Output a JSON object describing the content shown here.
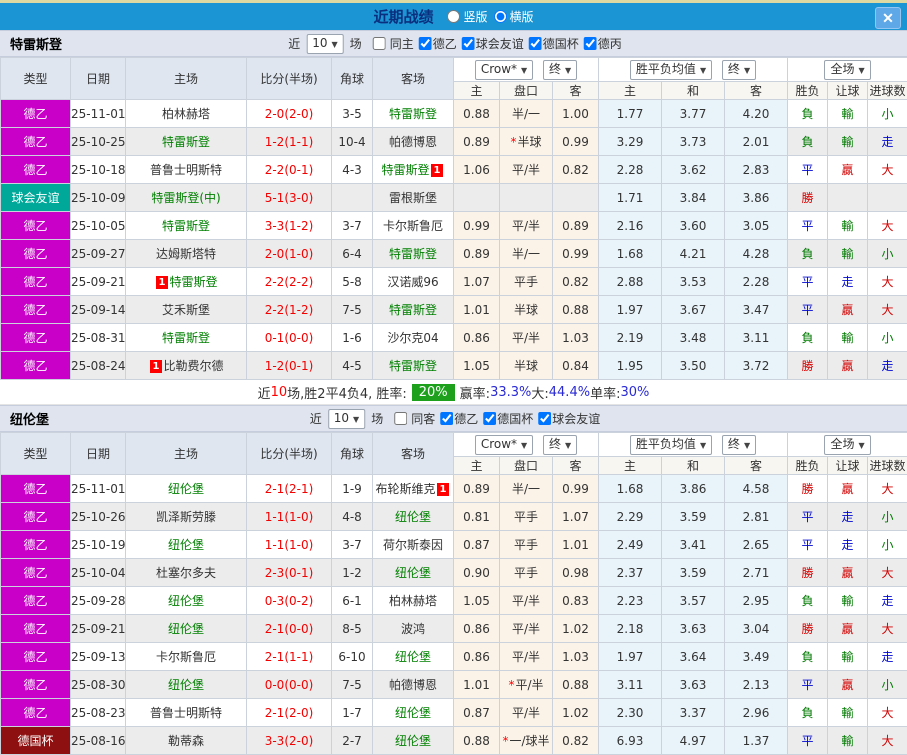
{
  "titlebar": {
    "title": "近期战绩",
    "radios": [
      {
        "label": "竖版",
        "checked": false
      },
      {
        "label": "横版",
        "checked": true
      }
    ],
    "close_icon": "✕"
  },
  "icons": {
    "chevron_down": "▼",
    "close": "✕"
  },
  "colors": {
    "titlebar_bg": "#1c95d4",
    "title_text": "#0a2f7e",
    "league_de2": "#c800c8",
    "league_friendly": "#00a89a",
    "league_decup": "#8f1010",
    "score_red": "#f30000",
    "focus_team_green": "#008000",
    "win_red": "#d30000",
    "draw_blue": "#0008d0",
    "lose_green": "#007a00",
    "odds_bg": "#fbf3e8",
    "avg_bg": "#e9f4fa",
    "rate_badge_bg": "#1da11d",
    "stat_value_blue": "#2a2ad4"
  },
  "table": {
    "cols": {
      "type": "类型",
      "date": "日期",
      "home": "主场",
      "score": "比分(半场)",
      "corner": "角球",
      "away": "客场",
      "odds_home": "主",
      "handicap": "盘口",
      "odds_away": "客",
      "avg_home": "主",
      "avg_draw": "和",
      "avg_away": "客",
      "result": "胜负",
      "handicap_result": "让球",
      "goals": "进球数"
    },
    "dropdowns": {
      "odds_source": "Crow*",
      "odds_final": "终",
      "avg_source": "胜平负均值",
      "avg_final": "终",
      "scope": "全场"
    }
  },
  "sections": [
    {
      "team": "特雷斯登",
      "filter": {
        "near_label": "近",
        "count": "10",
        "games_label": "场",
        "same": {
          "label": "同主",
          "checked": false
        },
        "leagues": [
          {
            "label": "德乙",
            "checked": true
          },
          {
            "label": "球会友谊",
            "checked": true
          },
          {
            "label": "德国杯",
            "checked": true
          },
          {
            "label": "德丙",
            "checked": true
          }
        ]
      },
      "rows": [
        {
          "type": "德乙",
          "type_key": "de2",
          "date": "25-11-01",
          "home": "柏林赫塔",
          "home_green": false,
          "score": "2-0(2-0)",
          "corner": "3-5",
          "away": "特雷斯登",
          "away_green": true,
          "odds_home": "0.88",
          "handicap": "半/一",
          "handicap_star": false,
          "odds_away": "1.00",
          "avg_home": "1.77",
          "avg_draw": "3.77",
          "avg_away": "4.20",
          "result": {
            "text": "負",
            "color": "green"
          },
          "handicap_result": {
            "text": "輸",
            "color": "green"
          },
          "goals": {
            "text": "小",
            "color": "green"
          }
        },
        {
          "type": "德乙",
          "type_key": "de2",
          "date": "25-10-25",
          "home": "特雷斯登",
          "home_green": true,
          "score": "1-2(1-1)",
          "corner": "10-4",
          "away": "帕德博恩",
          "away_green": false,
          "odds_home": "0.89",
          "handicap": "半球",
          "handicap_star": true,
          "odds_away": "0.99",
          "avg_home": "3.29",
          "avg_draw": "3.73",
          "avg_away": "2.01",
          "result": {
            "text": "負",
            "color": "green"
          },
          "handicap_result": {
            "text": "輸",
            "color": "green"
          },
          "goals": {
            "text": "走",
            "color": "blue"
          }
        },
        {
          "type": "德乙",
          "type_key": "de2",
          "date": "25-10-18",
          "home": "普鲁士明斯特",
          "home_green": false,
          "score": "2-2(0-1)",
          "corner": "4-3",
          "away": "特雷斯登",
          "away_green": true,
          "away_badge": "1",
          "away_badge_pos": "after",
          "odds_home": "1.06",
          "handicap": "平/半",
          "handicap_star": false,
          "odds_away": "0.82",
          "avg_home": "2.28",
          "avg_draw": "3.62",
          "avg_away": "2.83",
          "result": {
            "text": "平",
            "color": "blue"
          },
          "handicap_result": {
            "text": "贏",
            "color": "red"
          },
          "goals": {
            "text": "大",
            "color": "red"
          }
        },
        {
          "type": "球会友谊",
          "type_key": "friendly",
          "date": "25-10-09",
          "home": "特雷斯登(中)",
          "home_green": true,
          "score": "5-1(3-0)",
          "corner": "",
          "away": "雷根斯堡",
          "away_green": false,
          "odds_home": "",
          "handicap": "",
          "handicap_star": false,
          "odds_away": "",
          "avg_home": "1.71",
          "avg_draw": "3.84",
          "avg_away": "3.86",
          "result": {
            "text": "勝",
            "color": "red"
          },
          "handicap_result": {
            "text": "",
            "color": ""
          },
          "goals": {
            "text": "",
            "color": ""
          }
        },
        {
          "type": "德乙",
          "type_key": "de2",
          "date": "25-10-05",
          "home": "特雷斯登",
          "home_green": true,
          "score": "3-3(1-2)",
          "corner": "3-7",
          "away": "卡尔斯鲁厄",
          "away_green": false,
          "odds_home": "0.99",
          "handicap": "平/半",
          "handicap_star": false,
          "odds_away": "0.89",
          "avg_home": "2.16",
          "avg_draw": "3.60",
          "avg_away": "3.05",
          "result": {
            "text": "平",
            "color": "blue"
          },
          "handicap_result": {
            "text": "輸",
            "color": "green"
          },
          "goals": {
            "text": "大",
            "color": "red"
          }
        },
        {
          "type": "德乙",
          "type_key": "de2",
          "date": "25-09-27",
          "home": "达姆斯塔特",
          "home_green": false,
          "score": "2-0(1-0)",
          "corner": "6-4",
          "away": "特雷斯登",
          "away_green": true,
          "odds_home": "0.89",
          "handicap": "半/一",
          "handicap_star": false,
          "odds_away": "0.99",
          "avg_home": "1.68",
          "avg_draw": "4.21",
          "avg_away": "4.28",
          "result": {
            "text": "負",
            "color": "green"
          },
          "handicap_result": {
            "text": "輸",
            "color": "green"
          },
          "goals": {
            "text": "小",
            "color": "green"
          }
        },
        {
          "type": "德乙",
          "type_key": "de2",
          "date": "25-09-21",
          "home": "特雷斯登",
          "home_green": true,
          "home_badge": "1",
          "home_badge_pos": "before",
          "score": "2-2(2-2)",
          "corner": "5-8",
          "away": "汉诺威96",
          "away_green": false,
          "odds_home": "1.07",
          "handicap": "平手",
          "handicap_star": false,
          "odds_away": "0.82",
          "avg_home": "2.88",
          "avg_draw": "3.53",
          "avg_away": "2.28",
          "result": {
            "text": "平",
            "color": "blue"
          },
          "handicap_result": {
            "text": "走",
            "color": "blue"
          },
          "goals": {
            "text": "大",
            "color": "red"
          }
        },
        {
          "type": "德乙",
          "type_key": "de2",
          "date": "25-09-14",
          "home": "艾禾斯堡",
          "home_green": false,
          "score": "2-2(1-2)",
          "corner": "7-5",
          "away": "特雷斯登",
          "away_green": true,
          "odds_home": "1.01",
          "handicap": "半球",
          "handicap_star": false,
          "odds_away": "0.88",
          "avg_home": "1.97",
          "avg_draw": "3.67",
          "avg_away": "3.47",
          "result": {
            "text": "平",
            "color": "blue"
          },
          "handicap_result": {
            "text": "贏",
            "color": "red"
          },
          "goals": {
            "text": "大",
            "color": "red"
          }
        },
        {
          "type": "德乙",
          "type_key": "de2",
          "date": "25-08-31",
          "home": "特雷斯登",
          "home_green": true,
          "score": "0-1(0-0)",
          "corner": "1-6",
          "away": "沙尔克04",
          "away_green": false,
          "odds_home": "0.86",
          "handicap": "平/半",
          "handicap_star": false,
          "odds_away": "1.03",
          "avg_home": "2.19",
          "avg_draw": "3.48",
          "avg_away": "3.11",
          "result": {
            "text": "負",
            "color": "green"
          },
          "handicap_result": {
            "text": "輸",
            "color": "green"
          },
          "goals": {
            "text": "小",
            "color": "green"
          }
        },
        {
          "type": "德乙",
          "type_key": "de2",
          "date": "25-08-24",
          "home": "比勒费尔德",
          "home_green": false,
          "home_badge": "1",
          "home_badge_pos": "before",
          "score": "1-2(0-1)",
          "corner": "4-5",
          "away": "特雷斯登",
          "away_green": true,
          "odds_home": "1.05",
          "handicap": "半球",
          "handicap_star": false,
          "odds_away": "0.84",
          "avg_home": "1.95",
          "avg_draw": "3.50",
          "avg_away": "3.72",
          "result": {
            "text": "勝",
            "color": "red"
          },
          "handicap_result": {
            "text": "贏",
            "color": "red"
          },
          "goals": {
            "text": "走",
            "color": "blue"
          }
        }
      ],
      "summary": {
        "lead": [
          {
            "t": "近"
          },
          {
            "t": "10",
            "c": "red"
          },
          {
            "t": "场,胜2平4负4, 胜率:"
          }
        ],
        "rate": "20%",
        "stats": [
          {
            "label": "赢率:",
            "value": "33.3%"
          },
          {
            "label": " 大:",
            "value": "44.4%"
          },
          {
            "label": " 单率:",
            "value": "30%"
          }
        ]
      }
    },
    {
      "team": "纽伦堡",
      "filter": {
        "near_label": "近",
        "count": "10",
        "games_label": "场",
        "same": {
          "label": "同客",
          "checked": false
        },
        "leagues": [
          {
            "label": "德乙",
            "checked": true
          },
          {
            "label": "德国杯",
            "checked": true
          },
          {
            "label": "球会友谊",
            "checked": true
          }
        ]
      },
      "rows": [
        {
          "type": "德乙",
          "type_key": "de2",
          "date": "25-11-01",
          "home": "纽伦堡",
          "home_green": true,
          "score": "2-1(2-1)",
          "corner": "1-9",
          "away": "布轮斯维克",
          "away_green": false,
          "away_badge": "1",
          "away_badge_pos": "after",
          "odds_home": "0.89",
          "handicap": "半/一",
          "handicap_star": false,
          "odds_away": "0.99",
          "avg_home": "1.68",
          "avg_draw": "3.86",
          "avg_away": "4.58",
          "result": {
            "text": "勝",
            "color": "red"
          },
          "handicap_result": {
            "text": "贏",
            "color": "red"
          },
          "goals": {
            "text": "大",
            "color": "red"
          }
        },
        {
          "type": "德乙",
          "type_key": "de2",
          "date": "25-10-26",
          "home": "凯泽斯劳滕",
          "home_green": false,
          "score": "1-1(1-0)",
          "corner": "4-8",
          "away": "纽伦堡",
          "away_green": true,
          "odds_home": "0.81",
          "handicap": "平手",
          "handicap_star": false,
          "odds_away": "1.07",
          "avg_home": "2.29",
          "avg_draw": "3.59",
          "avg_away": "2.81",
          "result": {
            "text": "平",
            "color": "blue"
          },
          "handicap_result": {
            "text": "走",
            "color": "blue"
          },
          "goals": {
            "text": "小",
            "color": "green"
          }
        },
        {
          "type": "德乙",
          "type_key": "de2",
          "date": "25-10-19",
          "home": "纽伦堡",
          "home_green": true,
          "score": "1-1(1-0)",
          "corner": "3-7",
          "away": "荷尔斯泰因",
          "away_green": false,
          "odds_home": "0.87",
          "handicap": "平手",
          "handicap_star": false,
          "odds_away": "1.01",
          "avg_home": "2.49",
          "avg_draw": "3.41",
          "avg_away": "2.65",
          "result": {
            "text": "平",
            "color": "blue"
          },
          "handicap_result": {
            "text": "走",
            "color": "blue"
          },
          "goals": {
            "text": "小",
            "color": "green"
          }
        },
        {
          "type": "德乙",
          "type_key": "de2",
          "date": "25-10-04",
          "home": "杜塞尔多夫",
          "home_green": false,
          "score": "2-3(0-1)",
          "corner": "1-2",
          "away": "纽伦堡",
          "away_green": true,
          "odds_home": "0.90",
          "handicap": "平手",
          "handicap_star": false,
          "odds_away": "0.98",
          "avg_home": "2.37",
          "avg_draw": "3.59",
          "avg_away": "2.71",
          "result": {
            "text": "勝",
            "color": "red"
          },
          "handicap_result": {
            "text": "贏",
            "color": "red"
          },
          "goals": {
            "text": "大",
            "color": "red"
          }
        },
        {
          "type": "德乙",
          "type_key": "de2",
          "date": "25-09-28",
          "home": "纽伦堡",
          "home_green": true,
          "score": "0-3(0-2)",
          "corner": "6-1",
          "away": "柏林赫塔",
          "away_green": false,
          "odds_home": "1.05",
          "handicap": "平/半",
          "handicap_star": false,
          "odds_away": "0.83",
          "avg_home": "2.23",
          "avg_draw": "3.57",
          "avg_away": "2.95",
          "result": {
            "text": "負",
            "color": "green"
          },
          "handicap_result": {
            "text": "輸",
            "color": "green"
          },
          "goals": {
            "text": "走",
            "color": "blue"
          }
        },
        {
          "type": "德乙",
          "type_key": "de2",
          "date": "25-09-21",
          "home": "纽伦堡",
          "home_green": true,
          "score": "2-1(0-0)",
          "corner": "8-5",
          "away": "波鸿",
          "away_green": false,
          "odds_home": "0.86",
          "handicap": "平/半",
          "handicap_star": false,
          "odds_away": "1.02",
          "avg_home": "2.18",
          "avg_draw": "3.63",
          "avg_away": "3.04",
          "result": {
            "text": "勝",
            "color": "red"
          },
          "handicap_result": {
            "text": "贏",
            "color": "red"
          },
          "goals": {
            "text": "大",
            "color": "red"
          }
        },
        {
          "type": "德乙",
          "type_key": "de2",
          "date": "25-09-13",
          "home": "卡尔斯鲁厄",
          "home_green": false,
          "score": "2-1(1-1)",
          "corner": "6-10",
          "away": "纽伦堡",
          "away_green": true,
          "odds_home": "0.86",
          "handicap": "平/半",
          "handicap_star": false,
          "odds_away": "1.03",
          "avg_home": "1.97",
          "avg_draw": "3.64",
          "avg_away": "3.49",
          "result": {
            "text": "負",
            "color": "green"
          },
          "handicap_result": {
            "text": "輸",
            "color": "green"
          },
          "goals": {
            "text": "走",
            "color": "blue"
          }
        },
        {
          "type": "德乙",
          "type_key": "de2",
          "date": "25-08-30",
          "home": "纽伦堡",
          "home_green": true,
          "score": "0-0(0-0)",
          "corner": "7-5",
          "away": "帕德博恩",
          "away_green": false,
          "odds_home": "1.01",
          "handicap": "平/半",
          "handicap_star": true,
          "odds_away": "0.88",
          "avg_home": "3.11",
          "avg_draw": "3.63",
          "avg_away": "2.13",
          "result": {
            "text": "平",
            "color": "blue"
          },
          "handicap_result": {
            "text": "贏",
            "color": "red"
          },
          "goals": {
            "text": "小",
            "color": "green"
          }
        },
        {
          "type": "德乙",
          "type_key": "de2",
          "date": "25-08-23",
          "home": "普鲁士明斯特",
          "home_green": false,
          "score": "2-1(2-0)",
          "corner": "1-7",
          "away": "纽伦堡",
          "away_green": true,
          "odds_home": "0.87",
          "handicap": "平/半",
          "handicap_star": false,
          "odds_away": "1.02",
          "avg_home": "2.30",
          "avg_draw": "3.37",
          "avg_away": "2.96",
          "result": {
            "text": "負",
            "color": "green"
          },
          "handicap_result": {
            "text": "輸",
            "color": "green"
          },
          "goals": {
            "text": "大",
            "color": "red"
          }
        },
        {
          "type": "德国杯",
          "type_key": "decup",
          "date": "25-08-16",
          "home": "勒蒂森",
          "home_green": false,
          "score": "3-3(2-0)",
          "corner": "2-7",
          "away": "纽伦堡",
          "away_green": true,
          "odds_home": "0.88",
          "handicap": "一/球半",
          "handicap_star": true,
          "odds_away": "0.82",
          "avg_home": "6.93",
          "avg_draw": "4.97",
          "avg_away": "1.37",
          "result": {
            "text": "平",
            "color": "blue"
          },
          "handicap_result": {
            "text": "輸",
            "color": "green"
          },
          "goals": {
            "text": "大",
            "color": "red"
          }
        }
      ],
      "summary": null
    }
  ]
}
